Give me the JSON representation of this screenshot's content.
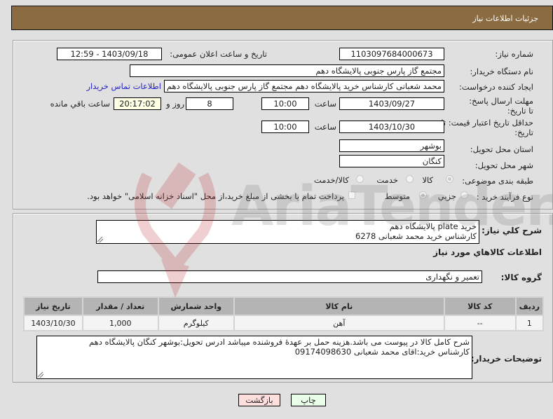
{
  "header": {
    "title": "جزئیات اطلاعات نیاز"
  },
  "form": {
    "need_number": {
      "label": "شماره نیاز:",
      "value": "1103097684000673"
    },
    "announce_datetime": {
      "label": "تاریخ و ساعت اعلان عمومی:",
      "value": "1403/09/18 - 12:59"
    },
    "buyer_org": {
      "label": "نام دستگاه خریدار:",
      "value": "مجتمع گاز پارس جنوبی  پالایشگاه دهم"
    },
    "requester": {
      "label": "ایجاد کننده درخواست:",
      "value": "محمد شعبانی کارشناس خرید پالایشگاه دهم  مجتمع گاز پارس جنوبی  پالایشگاه دهم",
      "contact_link": "اطلاعات تماس خریدار"
    },
    "reply_deadline": {
      "label": "مهلت ارسال پاسخ: تا تاریخ:",
      "date": "1403/09/27",
      "time_label": "ساعت",
      "time": "10:00",
      "days": "8",
      "days_label": "روز و",
      "remaining": "20:17:02",
      "remaining_label": "ساعت باقي مانده"
    },
    "price_validity": {
      "label": "حداقل تاریخ اعتبار قیمت: تا تاریخ:",
      "date": "1403/10/30",
      "time_label": "ساعت",
      "time": "10:00"
    },
    "delivery_province": {
      "label": "استان محل تحویل:",
      "value": "بوشهر"
    },
    "delivery_city": {
      "label": "شهر محل تحویل:",
      "value": "کنگان"
    },
    "category": {
      "label": "طبقه بندی موضوعی:",
      "options": [
        {
          "label": "کالا",
          "checked": true
        },
        {
          "label": "خدمت",
          "checked": false
        },
        {
          "label": "کالا/خدمت",
          "checked": false
        }
      ]
    },
    "purchase_type": {
      "label": "نوع فرآیند خرید :",
      "options": [
        {
          "label": "جزیي",
          "checked": false
        },
        {
          "label": "متوسط",
          "checked": true
        }
      ],
      "treasury_note": "پرداخت تمام یا بخشی از مبلغ خرید،از محل \"اسناد خزانه اسلامی\" خواهد بود."
    }
  },
  "details": {
    "general_desc": {
      "label": "شرح کلي نیاز:",
      "line1": "خرید plate پالایشگاه دهم",
      "line2": "کارشناس خرید محمد شعبانی 6278"
    },
    "goods_info_title": "اطلاعات کالاهاي مورد نیاز",
    "goods_group": {
      "label": "گروه کالا:",
      "value": "تعمیر و نگهداری"
    },
    "table": {
      "headers": [
        "ردیف",
        "کد کالا",
        "نام کالا",
        "واحد شمارش",
        "تعداد / مقدار",
        "تاریخ نیاز"
      ],
      "rows": [
        {
          "row": "1",
          "code": "--",
          "name": "آهن",
          "unit": "کیلوگرم",
          "qty": "1,000",
          "date": "1403/10/30"
        }
      ]
    },
    "buyer_notes": {
      "label": "توضیحات خریدار:",
      "line1": "شرح کامل کالا در پیوست می باشد.هزینه حمل بر عهدۀ فروشنده میباشد ادرس تحویل:بوشهر کنگان پالایشگاه دهم",
      "line2": "کارشناس خرید:اقای محمد شعبانی 09174098630"
    }
  },
  "buttons": {
    "print": "چاپ",
    "back": "بازگشت"
  },
  "watermark": {
    "text": "AriaTender.neT"
  }
}
